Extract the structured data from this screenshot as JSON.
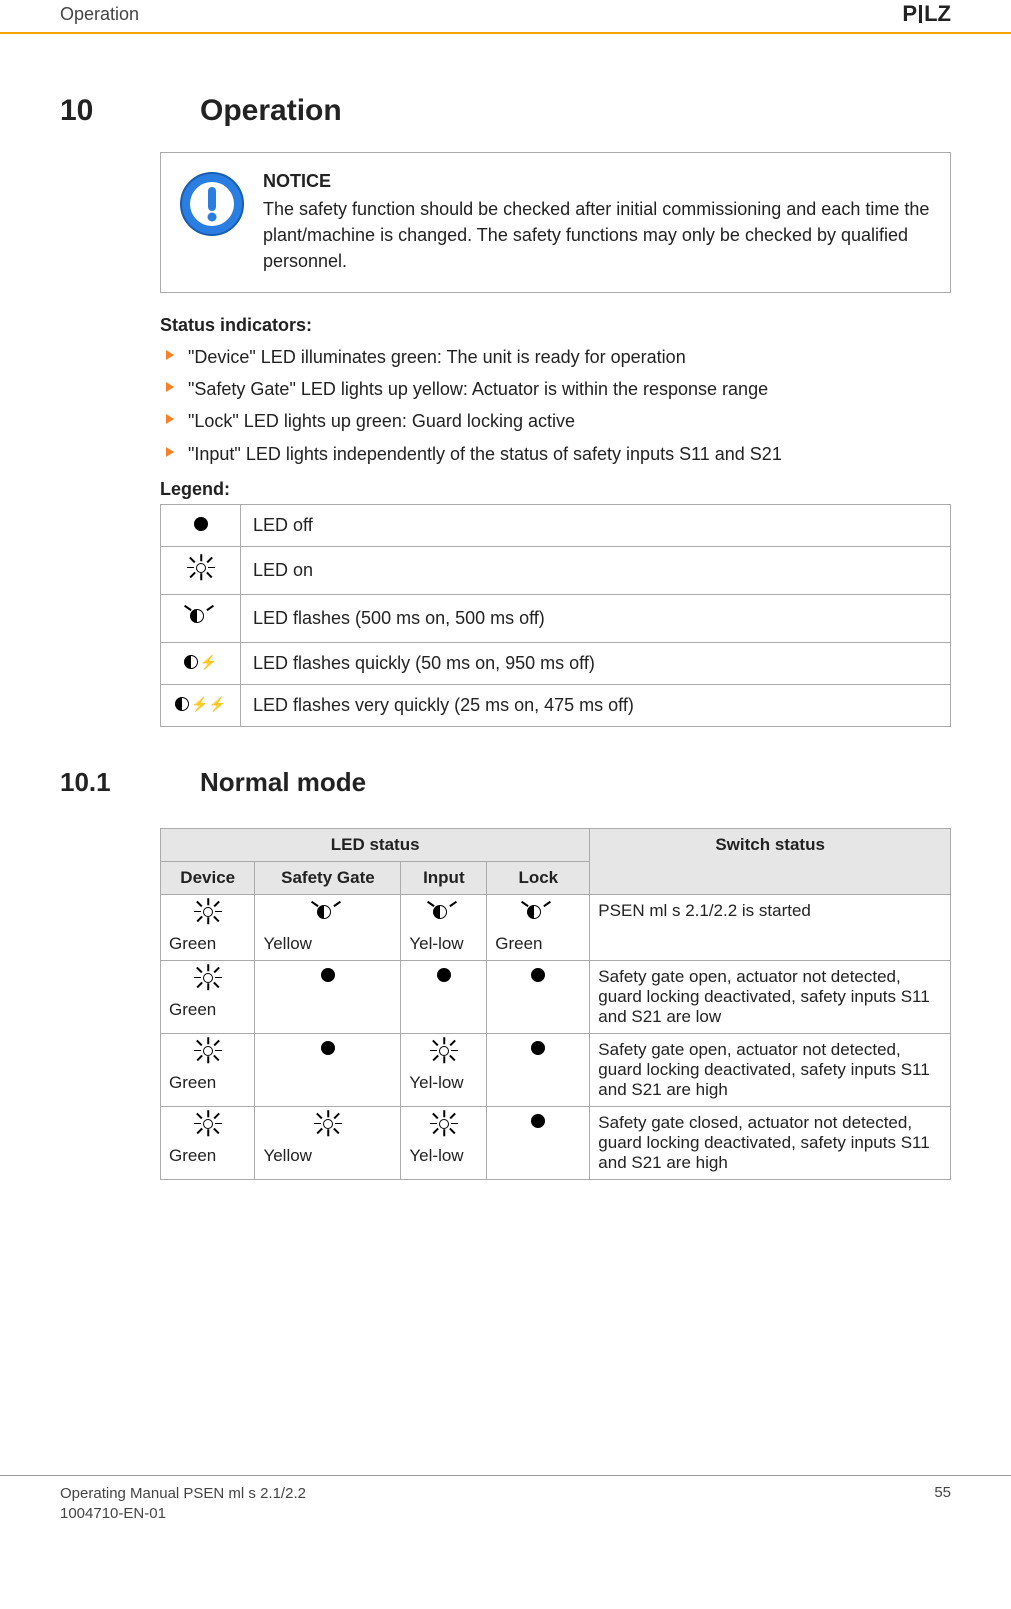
{
  "header": {
    "section": "Operation",
    "brand": "PILZ"
  },
  "section": {
    "number": "10",
    "title": "Operation"
  },
  "notice": {
    "title": "NOTICE",
    "text": "The safety function should be checked after initial commissioning and each time the plant/machine is changed. The safety functions may only be checked by qualified personnel."
  },
  "status": {
    "heading": "Status indicators:",
    "items": [
      "\"Device\" LED illuminates green: The unit is ready for operation",
      "\"Safety Gate\" LED lights up yellow: Actuator is within the response range",
      "\"Lock\" LED lights up green: Guard locking active",
      "\"Input\" LED lights independently of the status of safety inputs S11 and S21"
    ]
  },
  "legend": {
    "heading": "Legend:",
    "rows": [
      {
        "desc": "LED off"
      },
      {
        "desc": "LED on"
      },
      {
        "desc": "LED flashes (500 ms on, 500 ms off)"
      },
      {
        "desc": "LED flashes quickly (50 ms on, 950 ms off)"
      },
      {
        "desc": "LED flashes very quickly (25 ms on, 475 ms off)"
      }
    ]
  },
  "subsection": {
    "number": "10.1",
    "title": "Normal mode"
  },
  "table": {
    "group_header": "LED status",
    "columns": [
      "Device",
      "Safety Gate",
      "Input",
      "Lock",
      "Switch status"
    ],
    "rows": [
      {
        "device_color": "Green",
        "gate_color": "Yellow",
        "input_color": "Yel-low",
        "lock_color": "Green",
        "status": "PSEN ml s 2.1/2.2 is started"
      },
      {
        "device_color": "Green",
        "gate_color": "",
        "input_color": "",
        "lock_color": "",
        "status": "Safety gate open, actuator not detected, guard locking deactivated, safety inputs S11 and S21 are low"
      },
      {
        "device_color": "Green",
        "gate_color": "",
        "input_color": "Yel-low",
        "lock_color": "",
        "status": "Safety gate open, actuator not detected, guard locking deactivated, safety inputs S11 and S21 are high"
      },
      {
        "device_color": "Green",
        "gate_color": "Yellow",
        "input_color": "Yel-low",
        "lock_color": "",
        "status": "Safety gate closed, actuator not detected, guard locking deactivated, safety inputs S11 and S21 are high"
      }
    ]
  },
  "footer": {
    "line1": "Operating Manual PSEN ml s 2.1/2.2",
    "line2": "1004710-EN-01",
    "page": "55"
  }
}
